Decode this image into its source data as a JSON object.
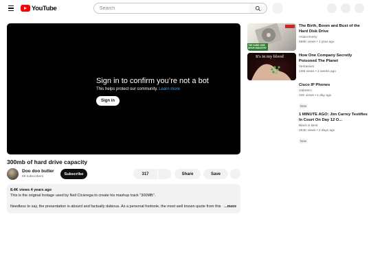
{
  "masthead": {
    "logo_text": "YouTube",
    "search_placeholder": "Search"
  },
  "player": {
    "title": "Sign in to confirm you’re not a bot",
    "subtitle": "This helps protect our community.",
    "learn_more": "Learn more",
    "signin_label": "Sign in"
  },
  "video": {
    "title": "300mb of hard drive capacity",
    "channel": "Doo doo butter",
    "subscribers": "69 subscribers",
    "subscribe_label": "Subscribe",
    "likes": "317",
    "share_label": "Share",
    "save_label": "Save"
  },
  "description": {
    "meta": "8.4K views  4 years ago",
    "line1": "This is the original footage used by Neil Cicierega to create his mashup track \"300MB\".",
    "line2": "Needless to say, the presentation is absurd and factually dubious. As a personal footnote, the most well known quote from this",
    "more_label": "...more"
  },
  "related": [
    {
      "title": "The Birth, Boom and Bust of the Hard Disk Drive",
      "channel": "Asianometry",
      "meta": "655K views  •  1 year ago",
      "thumb_text": "THE HARD DISK DRIVE INDUSTRY",
      "badge": ""
    },
    {
      "title": "How One Company Secretly Poisoned The Planet",
      "channel": "Veritasium",
      "meta": "13M views  •  2 weeks ago",
      "thumb_text": "It's in my blood",
      "badge": ""
    },
    {
      "title": "Cisco IP Phones",
      "channel": "clabretro",
      "meta": "34K views  •  1 day ago",
      "badge": "New"
    },
    {
      "title": "1 MINUTE AGO: Jim Carrey Testifies In Court On Day 12 O...",
      "channel": "Black is Best",
      "meta": "262K views  •  2 days ago",
      "badge": "New"
    }
  ]
}
